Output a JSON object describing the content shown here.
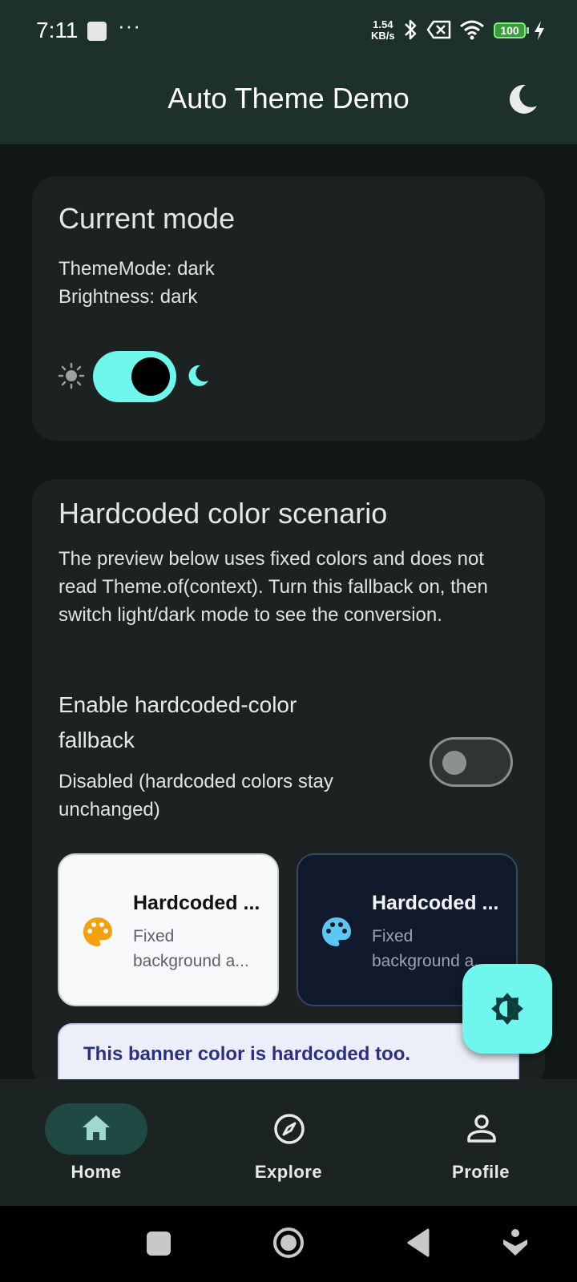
{
  "status_bar": {
    "time": "7:11",
    "dots": "···",
    "speed_value": "1.54",
    "speed_unit": "KB/s",
    "battery": "100"
  },
  "app_bar": {
    "title": "Auto Theme Demo",
    "theme_toggle_icon": "moon-icon"
  },
  "current_mode": {
    "title": "Current mode",
    "theme_mode": "ThemeMode: dark",
    "brightness": "Brightness: dark",
    "switch_on": true
  },
  "hardcoded": {
    "title": "Hardcoded color scenario",
    "description": "The preview below uses fixed colors and does not read Theme.of(context). Turn this fallback on, then switch light/dark mode to see the conversion.",
    "toggle_title_line1": "Enable hardcoded-color",
    "toggle_title_line2": "fallback",
    "toggle_subtitle_line1": "Disabled (hardcoded colors stay",
    "toggle_subtitle_line2": "unchanged)",
    "toggle_on": false,
    "light_card": {
      "title": "Hardcoded ...",
      "sub_line1": "Fixed",
      "sub_line2": "background a..."
    },
    "dark_card": {
      "title": "Hardcoded ...",
      "sub_line1": "Fixed",
      "sub_line2": "background a..."
    },
    "banner": "This banner color is hardcoded too."
  },
  "bottom_nav": {
    "items": [
      {
        "label": "Home",
        "icon": "home-icon",
        "selected": true
      },
      {
        "label": "Explore",
        "icon": "compass-icon",
        "selected": false
      },
      {
        "label": "Profile",
        "icon": "person-icon",
        "selected": false
      }
    ]
  },
  "colors": {
    "accent": "#6ff7ee",
    "app_bar": "#1e302b",
    "background": "#111816",
    "card": "#1c2222",
    "palette_orange": "#f5a10e",
    "palette_blue": "#5bc6f2"
  }
}
